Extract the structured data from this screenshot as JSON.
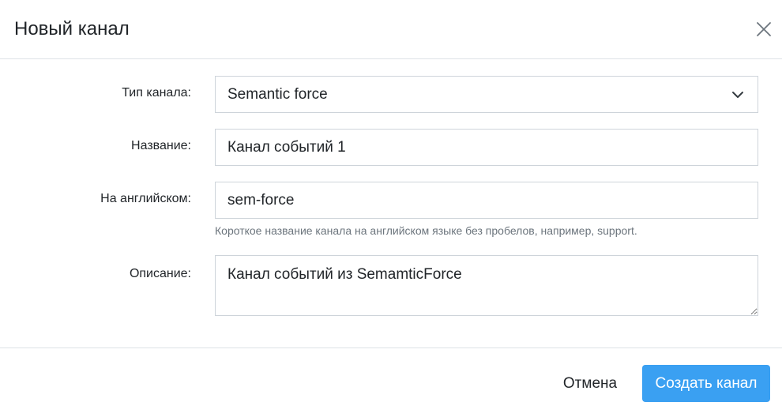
{
  "dialog": {
    "title": "Новый канал"
  },
  "form": {
    "channel_type": {
      "label": "Тип канала:",
      "selected_value": "Semantic force"
    },
    "name": {
      "label": "Название:",
      "value": "Канал событий 1"
    },
    "english_name": {
      "label": "На английском:",
      "value": "sem-force",
      "hint": "Короткое название канала на английском языке без пробелов, например, support."
    },
    "description": {
      "label": "Описание:",
      "value": "Канал событий из SemamticForce"
    }
  },
  "footer": {
    "cancel_label": "Отмена",
    "submit_label": "Создать канал"
  },
  "icons": {
    "close": "close-icon",
    "dropdown": "chevron-down-icon",
    "resize": "resize-handle-icon"
  },
  "colors": {
    "primary": "#3aa0f2",
    "border": "#ced4da",
    "divider": "#dee2e6",
    "hint_text": "#6c757d"
  }
}
